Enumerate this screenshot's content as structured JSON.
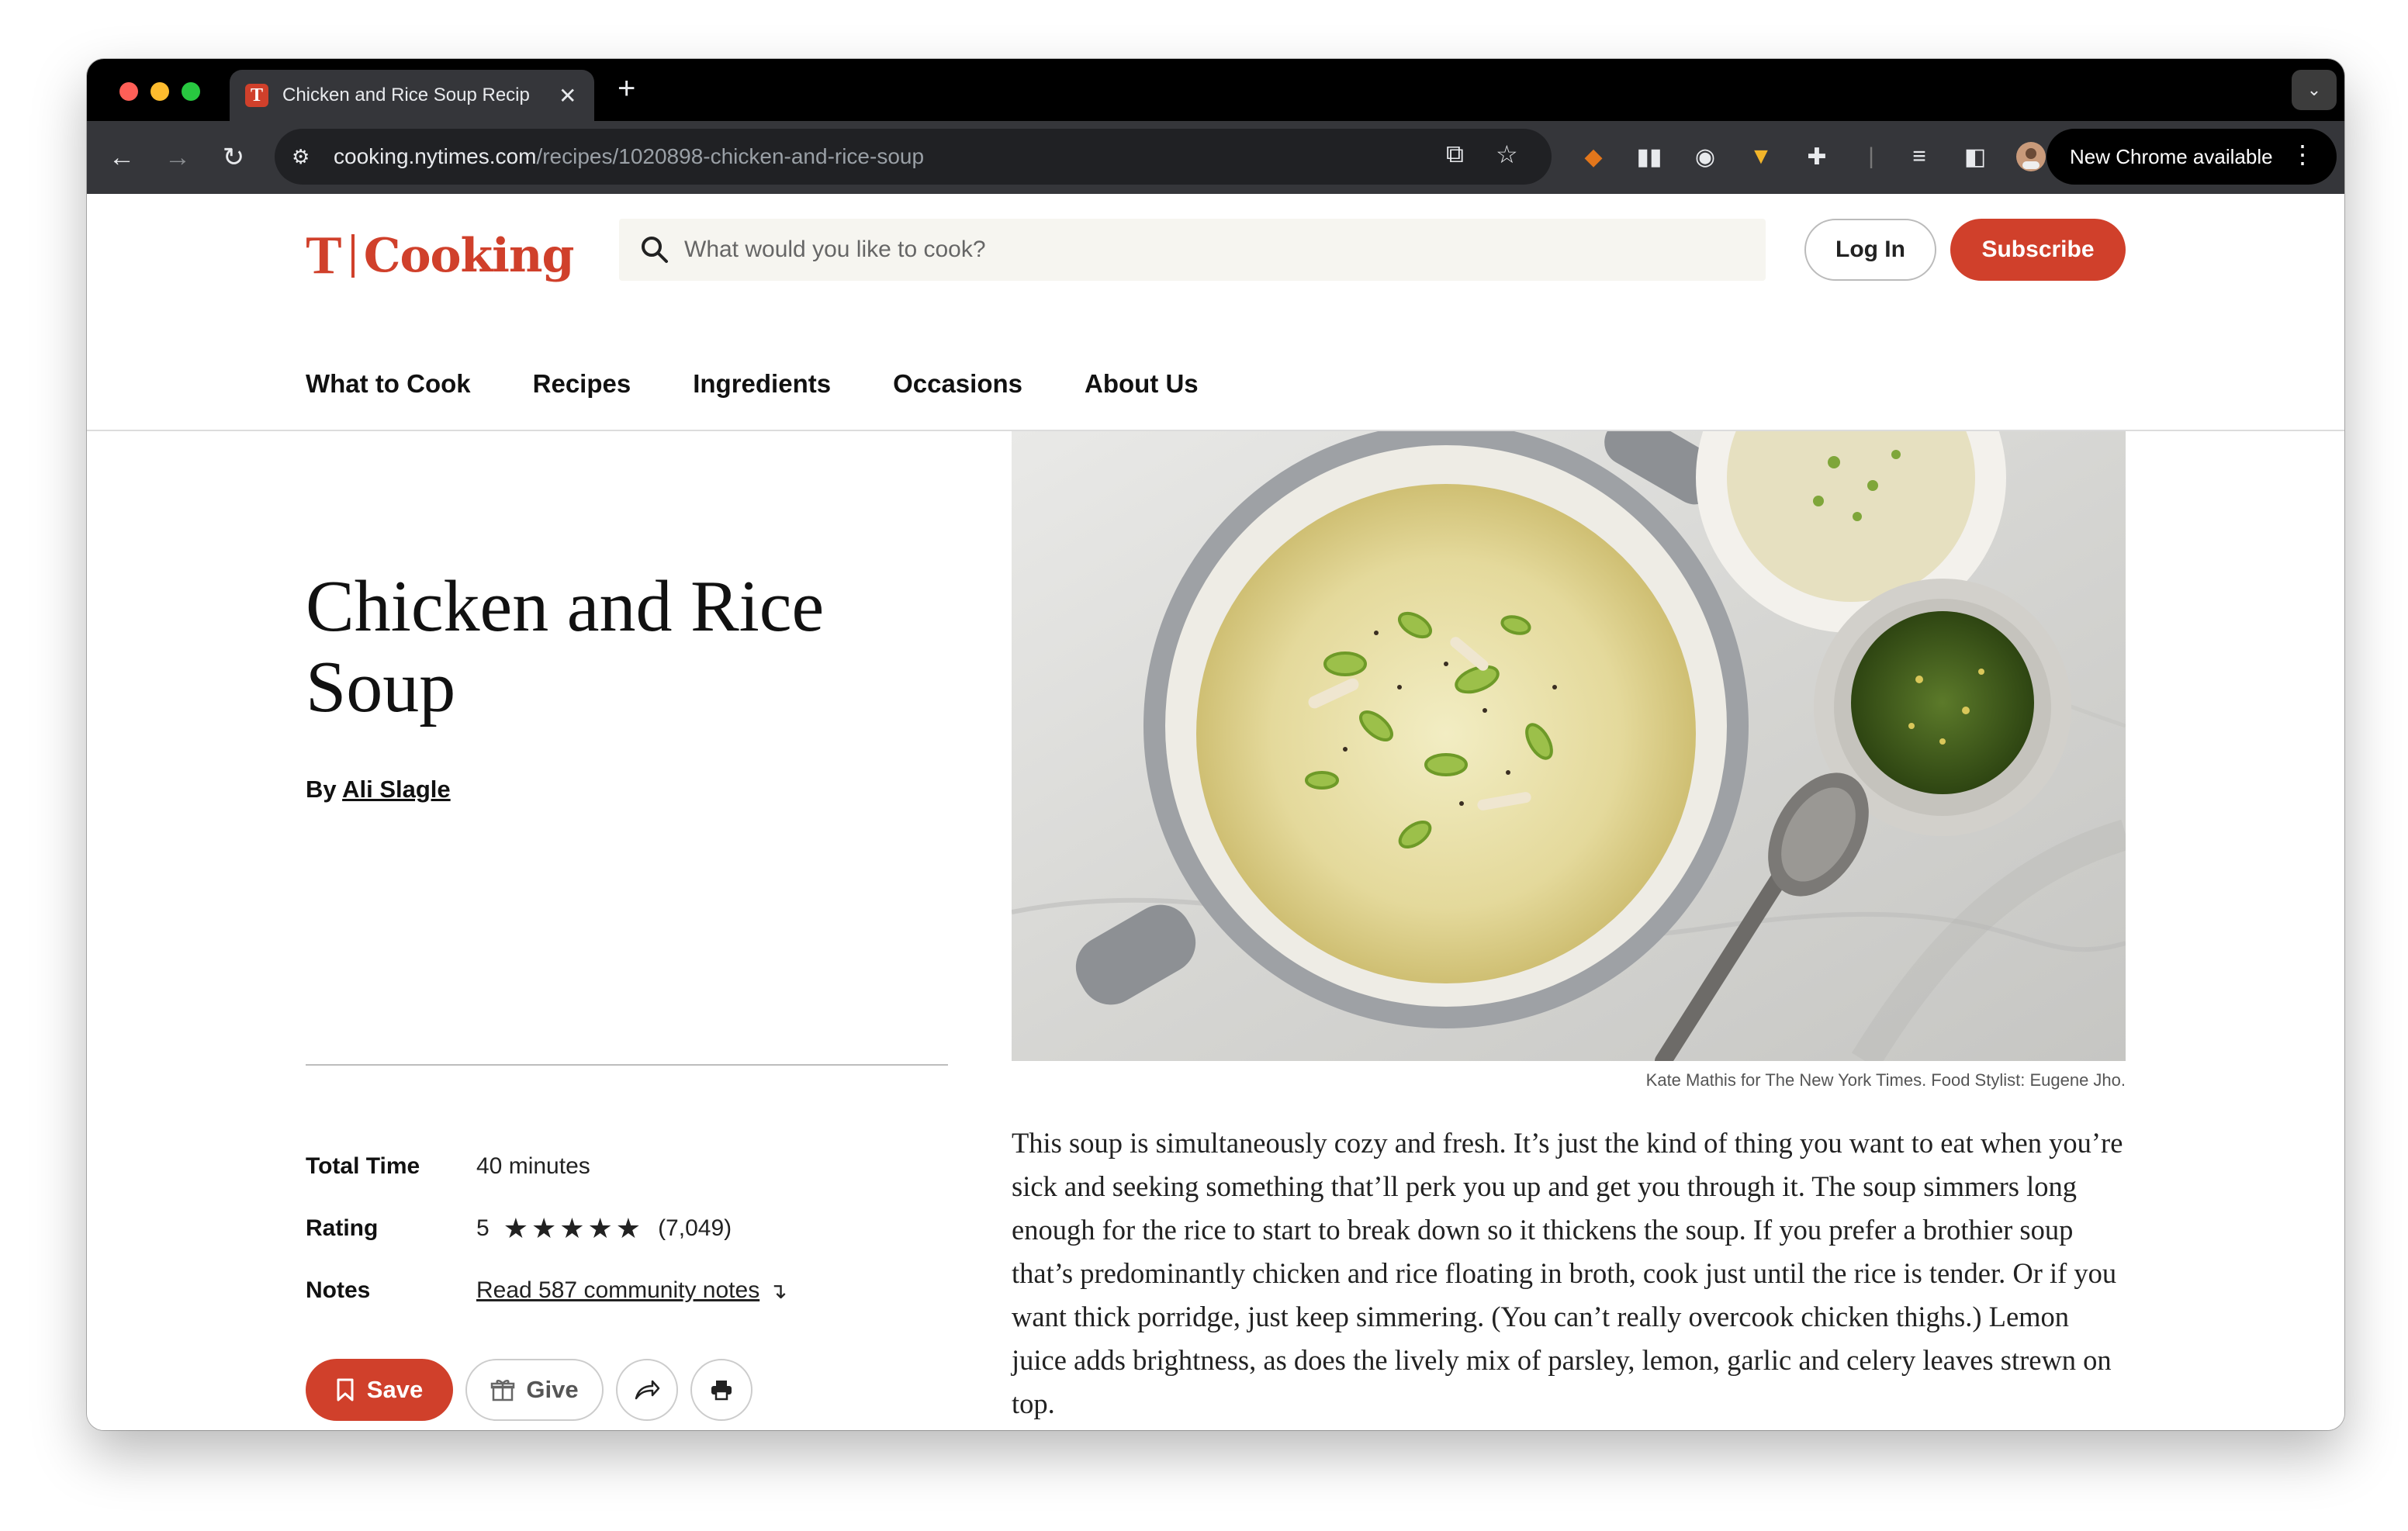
{
  "browser": {
    "tab_title": "Chicken and Rice Soup Recip",
    "url_host": "cooking.nytimes.com",
    "url_path": "/recipes/1020898-chicken-and-rice-soup",
    "update_label": "New Chrome available"
  },
  "header": {
    "logo_mark": "T",
    "logo_text": "Cooking",
    "search_placeholder": "What would you like to cook?",
    "login_label": "Log In",
    "subscribe_label": "Subscribe",
    "nav": [
      "What to Cook",
      "Recipes",
      "Ingredients",
      "Occasions",
      "About Us"
    ]
  },
  "recipe": {
    "title": "Chicken and Rice Soup",
    "by_prefix": "By",
    "author": "Ali Slagle",
    "total_time_label": "Total Time",
    "total_time_value": "40 minutes",
    "rating_label": "Rating",
    "rating_value": "5",
    "rating_stars": "★★★★★",
    "rating_count": "(7,049)",
    "notes_label": "Notes",
    "notes_link": "Read 587 community notes",
    "save_label": "Save",
    "give_label": "Give",
    "photo_caption": "Kate Mathis for The New York Times. Food Stylist: Eugene Jho.",
    "description": "This soup is simultaneously cozy and fresh. It’s just the kind of thing you want to eat when you’re sick and seeking something that’ll perk you up and get you through it. The soup simmers long enough for the rice to start to break down so it thickens the soup. If you prefer a brothier soup that’s predominantly chicken and rice floating in broth, cook just until the rice is tender. Or if you want thick porridge, just keep simmering. (You can’t really overcook chicken thighs.) Lemon juice adds brightness, as does the lively mix of parsley, lemon, garlic and celery leaves strewn on top."
  },
  "colors": {
    "brand_red": "#d0402b",
    "tab_strip": "#000000",
    "toolbar": "#35363a"
  }
}
